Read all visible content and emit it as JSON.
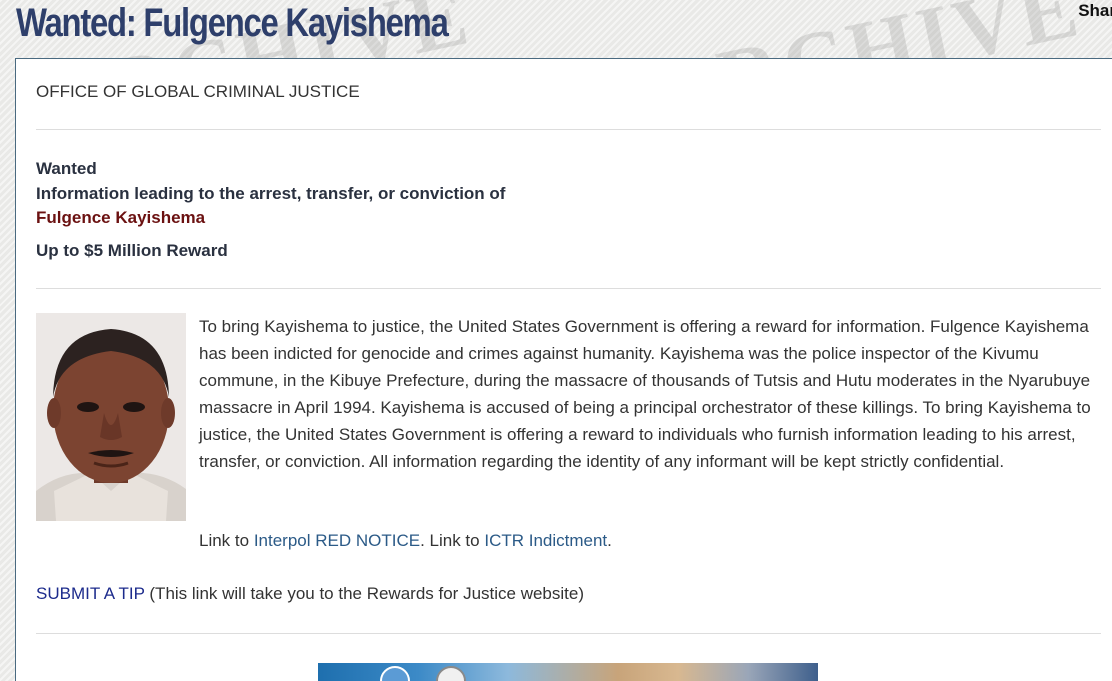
{
  "header": {
    "title": "Wanted: Fulgence Kayishema",
    "share_label": "Shar",
    "watermark_text": "WANTED • ARCHIVE"
  },
  "card": {
    "office": "OFFICE OF GLOBAL CRIMINAL JUSTICE",
    "wanted_label": "Wanted",
    "info_line": "Information leading to the arrest, transfer, or conviction of",
    "name": "Fulgence Kayishema",
    "reward": "Up to $5 Million Reward",
    "description": "To bring Kayishema to justice, the United States Government is offering a reward for information. Fulgence Kayishema has been indicted for genocide and crimes against humanity. Kayishema was the police inspector of the Kivumu commune, in the Kibuye Prefecture, during the massacre of thousands of Tutsis and Hutu moderates in the Nyarubuye massacre in April 1994. Kayishema is accused of being a principal orchestrator of these killings. To bring Kayishema to justice, the United States Government is offering a reward to individuals who furnish information leading to his arrest, transfer, or conviction.  All information regarding the identity of any informant will be kept strictly confidential.",
    "links": {
      "prefix1": "Link to ",
      "interpol_label": "Interpol RED NOTICE",
      "sep": ".  Link to ",
      "ictr_label": "ICTR Indictment",
      "suffix": "."
    },
    "tip": {
      "link_label": "SUBMIT A TIP",
      "note": " (This link will take you to the Rewards for Justice website)"
    }
  },
  "colors": {
    "title": "#2e3f6b",
    "name": "#6b1111",
    "link": "#2b5a87",
    "tip_link": "#1c2b8c"
  }
}
